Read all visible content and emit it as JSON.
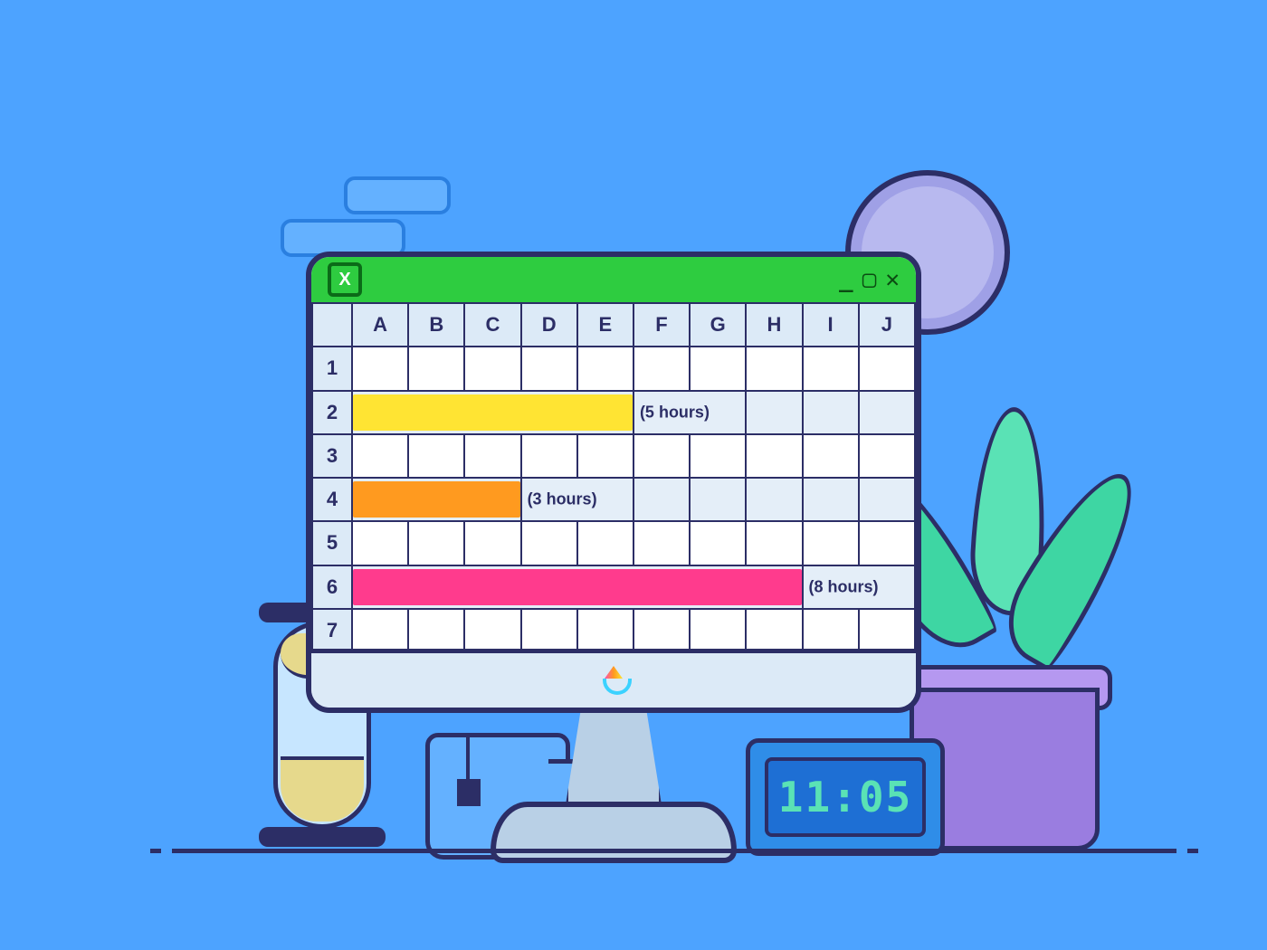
{
  "columns": [
    "A",
    "B",
    "C",
    "D",
    "E",
    "F",
    "G",
    "H",
    "I",
    "J"
  ],
  "rows": [
    "1",
    "2",
    "3",
    "4",
    "5",
    "6",
    "7"
  ],
  "titlebar": {
    "icon_letter": "X"
  },
  "bars": {
    "row2": {
      "span": 5,
      "color": "yellow",
      "label": "(5 hours)"
    },
    "row4": {
      "span": 3,
      "color": "orange",
      "label": "(3 hours)"
    },
    "row6": {
      "span": 8,
      "color": "pink",
      "label": "(8 hours)"
    }
  },
  "digital_clock": {
    "time": "11:05"
  }
}
